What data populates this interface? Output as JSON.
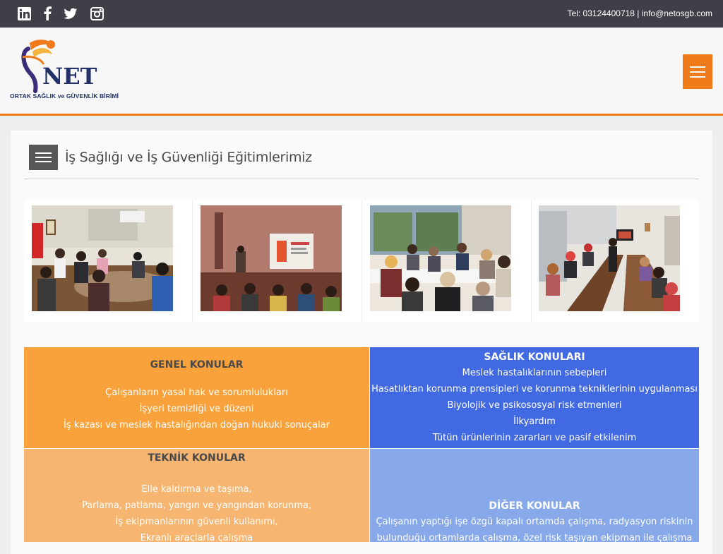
{
  "topbar": {
    "contact": "Tel: 03124400718 | info@netosgb.com",
    "social": [
      "linkedin-icon",
      "facebook-icon",
      "twitter-icon",
      "instagram-icon"
    ]
  },
  "header": {
    "logo_text": "NET",
    "logo_subtitle": "ORTAK SAĞLIK ve GÜVENLİK BİRİMİ"
  },
  "section": {
    "title": "İş Sağlığı ve İş Güvenliği Eğitimlerimiz"
  },
  "colors": {
    "accent": "#ef7b1a",
    "topbar": "#3f3f48",
    "general": "#f9a23c",
    "health": "#4169e1",
    "technical": "#f6b570",
    "other": "#87a8e9"
  },
  "topics": {
    "general": {
      "title": "GENEL KONULAR",
      "items": [
        "Çalışanların yasal hak ve sorumlulukları",
        "İşyeri temizliği ve düzeni",
        "İş kazası ve meslek hastalığından doğan hukuki sonuçalar"
      ]
    },
    "health": {
      "title": "SAĞLIK KONULARI",
      "items": [
        "Meslek hastalıklarının sebepleri",
        "Hasatlıktan korunma prensipleri ve korunma tekniklerinin uygulanması",
        "Biyolojik ve psikososyal risk etmenleri",
        "İlkyardım",
        "Tütün ürünlerinin zararları ve pasif etkilenim"
      ]
    },
    "technical": {
      "title": "TEKNİK KONULAR",
      "items": [
        "Elle kaldırma ve taşıma,",
        "Parlama, patlama, yangın ve yangından korunma,",
        "İş ekipmanlarının güvenli kullanımı,",
        "Ekranlı araçlarla çalışma"
      ]
    },
    "other": {
      "title": "DİĞER KONULAR",
      "items": [
        "Çalışanın yaptığı işe özgü kapalı ortamda çalışma, radyasyon riskinin",
        "bulunduğu ortamlarda çalışma, özel risk taşıyan ekipman ile çalışma"
      ]
    }
  }
}
